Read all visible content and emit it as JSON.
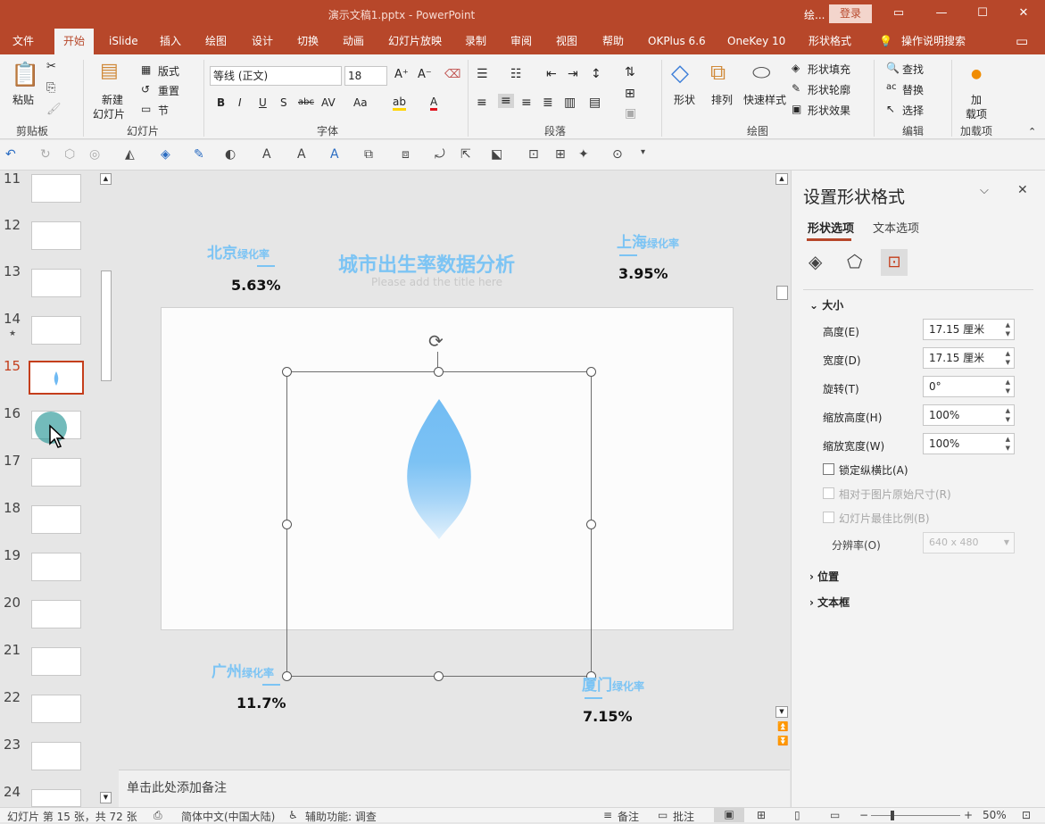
{
  "titlebar": {
    "title": "演示文稿1.pptx  -  PowerPoint",
    "user": "绘...",
    "login": "登录"
  },
  "tabs": [
    "文件",
    "开始",
    "iSlide",
    "插入",
    "绘图",
    "设计",
    "切换",
    "动画",
    "幻灯片放映",
    "录制",
    "审阅",
    "视图",
    "帮助",
    "OKPlus 6.6",
    "OneKey 10",
    "形状格式",
    "操作说明搜索"
  ],
  "ribbon": {
    "clipboard": {
      "paste": "粘贴",
      "label": "剪贴板"
    },
    "slides": {
      "new": "新建",
      "new2": "幻灯片",
      "layout": "版式",
      "reset": "重置",
      "section": "节",
      "label": "幻灯片"
    },
    "font": {
      "name": "等线 (正文)",
      "size": "18",
      "label": "字体"
    },
    "paragraph": {
      "label": "段落"
    },
    "drawing": {
      "shape": "形状",
      "arrange": "排列",
      "quickstyle": "快速样式",
      "fill": "形状填充",
      "outline": "形状轮廓",
      "effect": "形状效果",
      "label": "绘图"
    },
    "editing": {
      "find": "查找",
      "replace": "替换",
      "select": "选择",
      "label": "编辑"
    },
    "addins": {
      "addin1": "加",
      "addin2": "载项",
      "label": "加载项"
    }
  },
  "thumbnails": [
    "11",
    "12",
    "13",
    "14",
    "15",
    "16",
    "17",
    "18",
    "19",
    "20",
    "21",
    "22",
    "23",
    "24"
  ],
  "slide": {
    "header_title": "城市出生率数据分析",
    "header_sub": "Please add the title here",
    "cities": [
      {
        "name": "北京",
        "suffix": "绿化率",
        "value": "5.63%"
      },
      {
        "name": "上海",
        "suffix": "绿化率",
        "value": "3.95%"
      },
      {
        "name": "广州",
        "suffix": "绿化率",
        "value": "11.7%"
      },
      {
        "name": "厦门",
        "suffix": "绿化率",
        "value": "7.15%"
      }
    ]
  },
  "notes": "单击此处添加备注",
  "pane": {
    "title": "设置形状格式",
    "tab_shape": "形状选项",
    "tab_text": "文本选项",
    "section_size": "大小",
    "height_label": "高度(E)",
    "height": "17.15 厘米",
    "width_label": "宽度(D)",
    "width": "17.15 厘米",
    "rotate_label": "旋转(T)",
    "rotate": "0°",
    "scaleh_label": "缩放高度(H)",
    "scaleh": "100%",
    "scalew_label": "缩放宽度(W)",
    "scalew": "100%",
    "lock": "锁定纵横比(A)",
    "relative": "相对于图片原始尺寸(R)",
    "best": "幻灯片最佳比例(B)",
    "resolution_label": "分辨率(O)",
    "resolution": "640 x 480",
    "section_pos": "位置",
    "section_textbox": "文本框"
  },
  "status": {
    "slide": "幻灯片 第 15 张，共 72 张",
    "lang": "简体中文(中国大陆)",
    "access": "辅助功能: 调查",
    "notes": "备注",
    "comments": "批注",
    "zoom": "50%"
  },
  "colors": {
    "accent": "#b7472a",
    "slide_text": "#7cc4f4",
    "drop": "#6fbaf3"
  }
}
